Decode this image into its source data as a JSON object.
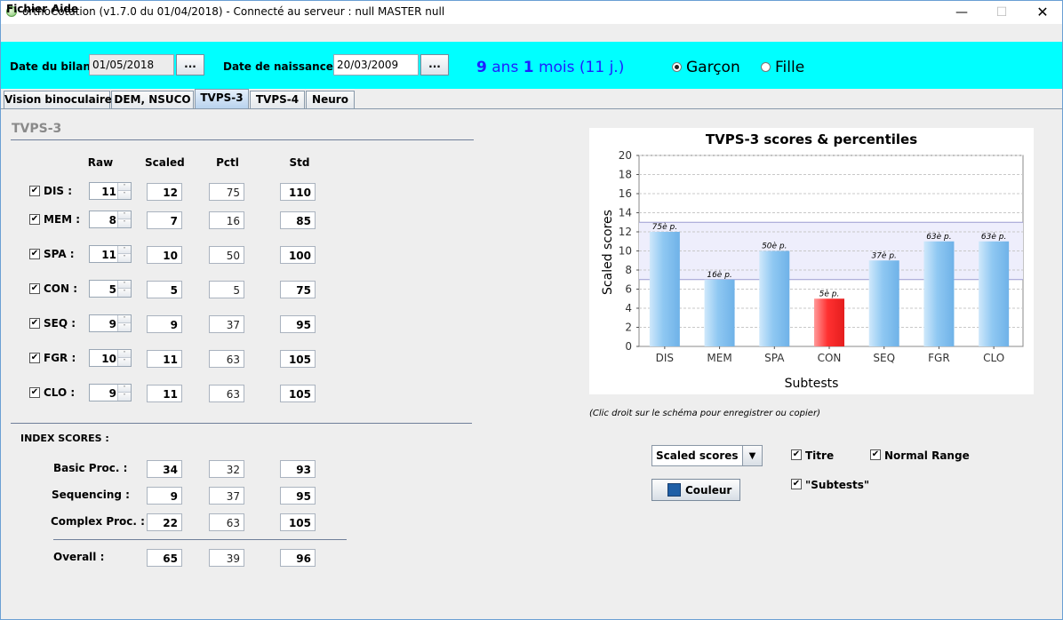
{
  "window": {
    "title": "orthoCotation (v1.7.0 du 01/04/2018) - Connecté au serveur : null MASTER null",
    "minimize": "—",
    "maximize": "☐",
    "close": "✕"
  },
  "menu": {
    "fichier": "Fichier",
    "aide": "Aide"
  },
  "header": {
    "bilan_label": "Date du bilan :",
    "bilan_value": "01/05/2018",
    "naissance_label": "Date de naissance :",
    "naissance_value": "20/03/2009",
    "dots": "...",
    "age": {
      "years": "9",
      "years_unit": " ans ",
      "months": "1",
      "months_unit": " mois (11 j.)"
    },
    "gender": {
      "male": "Garçon",
      "female": "Fille",
      "selected": "male"
    },
    "background_color": "#00ffff"
  },
  "tabs": [
    {
      "label": "Vision binoculaire",
      "active": false
    },
    {
      "label": "DEM, NSUCO",
      "active": false
    },
    {
      "label": "TVPS-3",
      "active": true
    },
    {
      "label": "TVPS-4",
      "active": false
    },
    {
      "label": "Neuro",
      "active": false
    }
  ],
  "scores": {
    "section_title": "TVPS-3",
    "columns": {
      "raw": "Raw",
      "scaled": "Scaled",
      "pctl": "Pctl",
      "std": "Std"
    },
    "rows": [
      {
        "label": "DIS :",
        "checked": true,
        "raw": "11",
        "scaled": "12",
        "pctl": "75",
        "std": "110"
      },
      {
        "label": "MEM :",
        "checked": true,
        "raw": "8",
        "scaled": "7",
        "pctl": "16",
        "std": "85"
      },
      {
        "label": "SPA :",
        "checked": true,
        "raw": "11",
        "scaled": "10",
        "pctl": "50",
        "std": "100"
      },
      {
        "label": "CON :",
        "checked": true,
        "raw": "5",
        "scaled": "5",
        "pctl": "5",
        "std": "75"
      },
      {
        "label": "SEQ :",
        "checked": true,
        "raw": "9",
        "scaled": "9",
        "pctl": "37",
        "std": "95"
      },
      {
        "label": "FGR :",
        "checked": true,
        "raw": "10",
        "scaled": "11",
        "pctl": "63",
        "std": "105"
      },
      {
        "label": "CLO :",
        "checked": true,
        "raw": "9",
        "scaled": "11",
        "pctl": "63",
        "std": "105"
      }
    ]
  },
  "index": {
    "title": "INDEX SCORES :",
    "rows": [
      {
        "label": "Basic Proc. :",
        "scaled": "34",
        "pctl": "32",
        "std": "93"
      },
      {
        "label": "Sequencing :",
        "scaled": "9",
        "pctl": "37",
        "std": "95"
      },
      {
        "label": "Complex Proc. :",
        "scaled": "22",
        "pctl": "63",
        "std": "105"
      }
    ],
    "overall": {
      "label": "Overall :",
      "scaled": "65",
      "pctl": "39",
      "std": "96"
    }
  },
  "chart_data": {
    "type": "bar",
    "title": "TVPS-3 scores & percentiles",
    "xlabel": "Subtests",
    "ylabel": "Scaled scores",
    "categories": [
      "DIS",
      "MEM",
      "SPA",
      "CON",
      "SEQ",
      "FGR",
      "CLO"
    ],
    "values": [
      12,
      7,
      10,
      5,
      9,
      11,
      11
    ],
    "bar_labels": [
      "75è p.",
      "16è p.",
      "50è p.",
      "5è p.",
      "37è p.",
      "63è p.",
      "63è p."
    ],
    "highlight": [
      false,
      false,
      false,
      true,
      false,
      false,
      false
    ],
    "ylim": [
      0,
      20
    ],
    "yticks": [
      0,
      2,
      4,
      6,
      8,
      10,
      12,
      14,
      16,
      18,
      20
    ],
    "normal_range": [
      7,
      13
    ],
    "grid": true,
    "legend": "none",
    "colors": {
      "bar": "#8fc8f2",
      "bar_highlight": "#ff3030",
      "normal_range": "#eeeefc"
    }
  },
  "chart_note": "(Clic droit sur le schéma pour enregistrer ou copier)",
  "controls": {
    "combo_value": "Scaled scores",
    "color_button": "Couleur",
    "color_swatch": "#1f5fa6",
    "titre": {
      "label": "Titre",
      "checked": true
    },
    "normal_range": {
      "label": "Normal Range",
      "checked": true
    },
    "subtests": {
      "label": "\"Subtests\"",
      "checked": true
    }
  },
  "icons": {
    "check": "✔",
    "spin_up": "˄",
    "spin_down": "˅",
    "combo_arrow": "▼"
  }
}
